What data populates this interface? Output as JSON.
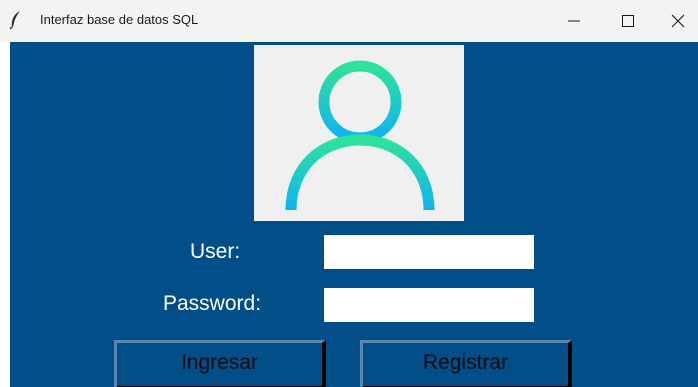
{
  "window": {
    "title": "Interfaz base de datos SQL",
    "icon": "feather-icon",
    "controls": [
      "minimize-icon",
      "maximize-icon",
      "close-icon"
    ]
  },
  "login": {
    "avatar_icon": "user-icon",
    "user_label": "User:",
    "user_value": "",
    "password_label": "Password:",
    "password_value": "",
    "login_button": "Ingresar",
    "register_button": "Registrar"
  },
  "colors": {
    "background": "#024e89",
    "avatar_gradient_top": "#2de29b",
    "avatar_gradient_bottom": "#0fb4f0",
    "avatar_box": "#f0f0f0"
  }
}
